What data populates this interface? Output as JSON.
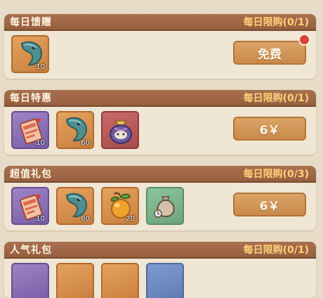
{
  "colors": {
    "header_bg": "#96603f",
    "title_text": "#fff4e1",
    "limit_text": "#ffd27a",
    "card_bg": "#efe6d3",
    "button_bg": "#c98a4a",
    "notify_dot": "#d9423a"
  },
  "sections": [
    {
      "title": "每日馈赠",
      "limit": "每日限购(0/1)",
      "button": "免费",
      "has_notification": true,
      "items": [
        {
          "icon": "teal-fish-icon",
          "frame": "orange",
          "qty": "10"
        }
      ]
    },
    {
      "title": "每日特惠",
      "limit": "每日限购(0/1)",
      "button": "6￥",
      "items": [
        {
          "icon": "ticket-icon",
          "frame": "purple",
          "qty": "10"
        },
        {
          "icon": "teal-fish-icon",
          "frame": "orange",
          "qty": "60"
        },
        {
          "icon": "treasure-bag-icon",
          "frame": "red",
          "qty": ""
        }
      ]
    },
    {
      "title": "超值礼包",
      "limit": "每日限购(0/3)",
      "button": "6￥",
      "items": [
        {
          "icon": "ticket-icon",
          "frame": "purple",
          "qty": "10"
        },
        {
          "icon": "teal-fish-icon",
          "frame": "orange",
          "qty": "60"
        },
        {
          "icon": "orange-fruit-icon",
          "frame": "orange",
          "qty": "20"
        },
        {
          "icon": "sack-icon",
          "frame": "green",
          "qty": ""
        }
      ]
    },
    {
      "title": "人气礼包",
      "limit": "每日限购(0/1)",
      "items": []
    }
  ]
}
